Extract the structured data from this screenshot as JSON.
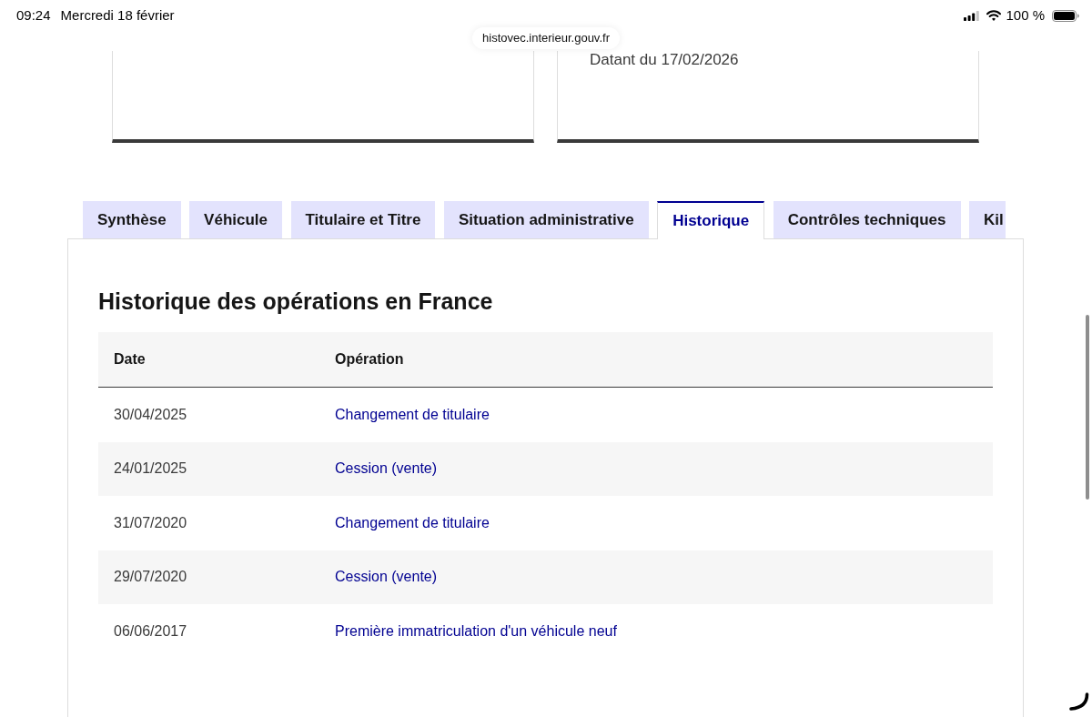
{
  "status_bar": {
    "time": "09:24",
    "date": "Mercredi 18 février",
    "battery": "100 %"
  },
  "address_bar": {
    "url": "histovec.interieur.gouv.fr"
  },
  "summary_cards": [
    {
      "kind": "empty"
    },
    {
      "kind": "dated",
      "text": "Datant du 17/02/2026"
    }
  ],
  "tabs": [
    {
      "label": "Synthèse",
      "selected": false
    },
    {
      "label": "Véhicule",
      "selected": false
    },
    {
      "label": "Titulaire et Titre",
      "selected": false
    },
    {
      "label": "Situation administrative",
      "selected": false
    },
    {
      "label": "Historique",
      "selected": true
    },
    {
      "label": "Contrôles techniques",
      "selected": false
    },
    {
      "label": "Kil",
      "selected": false
    }
  ],
  "panel": {
    "title": "Historique des opérations en France",
    "table": {
      "columns": [
        "Date",
        "Opération"
      ],
      "rows": [
        {
          "date": "30/04/2025",
          "operation": "Changement de titulaire"
        },
        {
          "date": "24/01/2025",
          "operation": "Cession (vente)"
        },
        {
          "date": "31/07/2020",
          "operation": "Changement de titulaire"
        },
        {
          "date": "29/07/2020",
          "operation": "Cession (vente)"
        },
        {
          "date": "06/06/2017",
          "operation": "Première immatriculation d'un véhicule neuf"
        }
      ]
    }
  }
}
